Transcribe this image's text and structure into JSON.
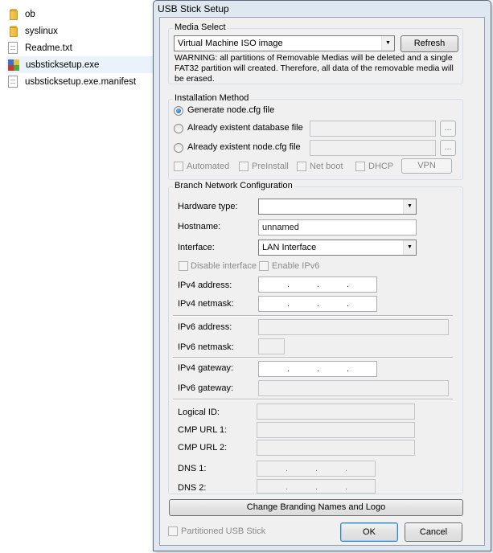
{
  "explorer": {
    "files": [
      {
        "name": "ob",
        "icon": "folder-icon"
      },
      {
        "name": "syslinux",
        "icon": "folder-icon"
      },
      {
        "name": "Readme.txt",
        "icon": "text-file-icon"
      },
      {
        "name": "usbsticksetup.exe",
        "icon": "exe-icon"
      },
      {
        "name": "usbsticksetup.exe.manifest",
        "icon": "file-icon"
      }
    ]
  },
  "dialog": {
    "title": "USB Stick Setup",
    "media_select": {
      "title": "Media Select",
      "selected": "Virtual Machine ISO image",
      "refresh_label": "Refresh",
      "warning": "WARNING: all partitions of Removable Medias will be deleted and a single FAT32 partition will created. Therefore, all data of the removable media will be erased."
    },
    "installation": {
      "title": "Installation Method",
      "options": [
        {
          "label": "Generate node.cfg file",
          "selected": true
        },
        {
          "label": "Already existent database file",
          "selected": false
        },
        {
          "label": "Already existent node.cfg file",
          "selected": false
        }
      ],
      "browse_label": "...",
      "checks": [
        "Automated",
        "PreInstall",
        "Net boot",
        "DHCP"
      ],
      "vpn_label": "VPN"
    },
    "branch": {
      "title": "Branch Network Configuration",
      "hardware_type_label": "Hardware type:",
      "hardware_type_value": "",
      "hostname_label": "Hostname:",
      "hostname_value": "unnamed",
      "interface_label": "Interface:",
      "interface_value": "LAN Interface",
      "disable_interface_label": "Disable interface",
      "enable_ipv6_label": "Enable IPv6",
      "ipv4_address_label": "IPv4 address:",
      "ipv4_netmask_label": "IPv4 netmask:",
      "ipv6_address_label": "IPv6 address:",
      "ipv6_netmask_label": "IPv6 netmask:",
      "ipv4_gateway_label": "IPv4 gateway:",
      "ipv6_gateway_label": "IPv6 gateway:",
      "logical_id_label": "Logical ID:",
      "cmp_url1_label": "CMP URL 1:",
      "cmp_url2_label": "CMP URL 2:",
      "dns1_label": "DNS 1:",
      "dns2_label": "DNS 2:",
      "ip_dot": "."
    },
    "branding_label": "Change Branding Names and Logo",
    "partitioned_label": "Partitioned USB Stick",
    "ok_label": "OK",
    "cancel_label": "Cancel"
  }
}
